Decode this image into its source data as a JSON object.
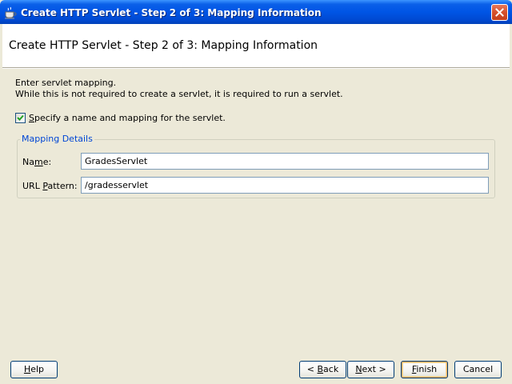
{
  "window": {
    "title": "Create HTTP Servlet - Step 2 of 3: Mapping Information",
    "icon": "coffee-cup-icon",
    "close_icon": "close-icon",
    "colors": {
      "titlebar": "#0055e5",
      "background": "#ece9d8",
      "group_legend": "#0046d5",
      "close_button": "#d5502c"
    }
  },
  "header": {
    "title": "Create HTTP Servlet - Step 2 of 3: Mapping Information"
  },
  "content": {
    "desc_line1": "Enter servlet mapping.",
    "desc_line2": "While this is not required to create a servlet, it is required to run a servlet.",
    "checkbox": {
      "checked": true,
      "label_mnemonic": "S",
      "label_rest": "pecify a name and mapping for the servlet."
    },
    "mapping_group": {
      "legend": "Mapping Details",
      "name_label_pre": "Na",
      "name_label_mnemonic": "m",
      "name_label_post": "e:",
      "name_value": "GradesServlet",
      "url_label_pre": "URL ",
      "url_label_mnemonic": "P",
      "url_label_post": "attern:",
      "url_value": "/gradesservlet"
    }
  },
  "buttons": {
    "help_mnemonic": "H",
    "help_rest": "elp",
    "back_pre": "< ",
    "back_mnemonic": "B",
    "back_rest": "ack",
    "next_mnemonic": "N",
    "next_rest": "ext >",
    "finish_mnemonic": "F",
    "finish_rest": "inish",
    "cancel": "Cancel"
  }
}
